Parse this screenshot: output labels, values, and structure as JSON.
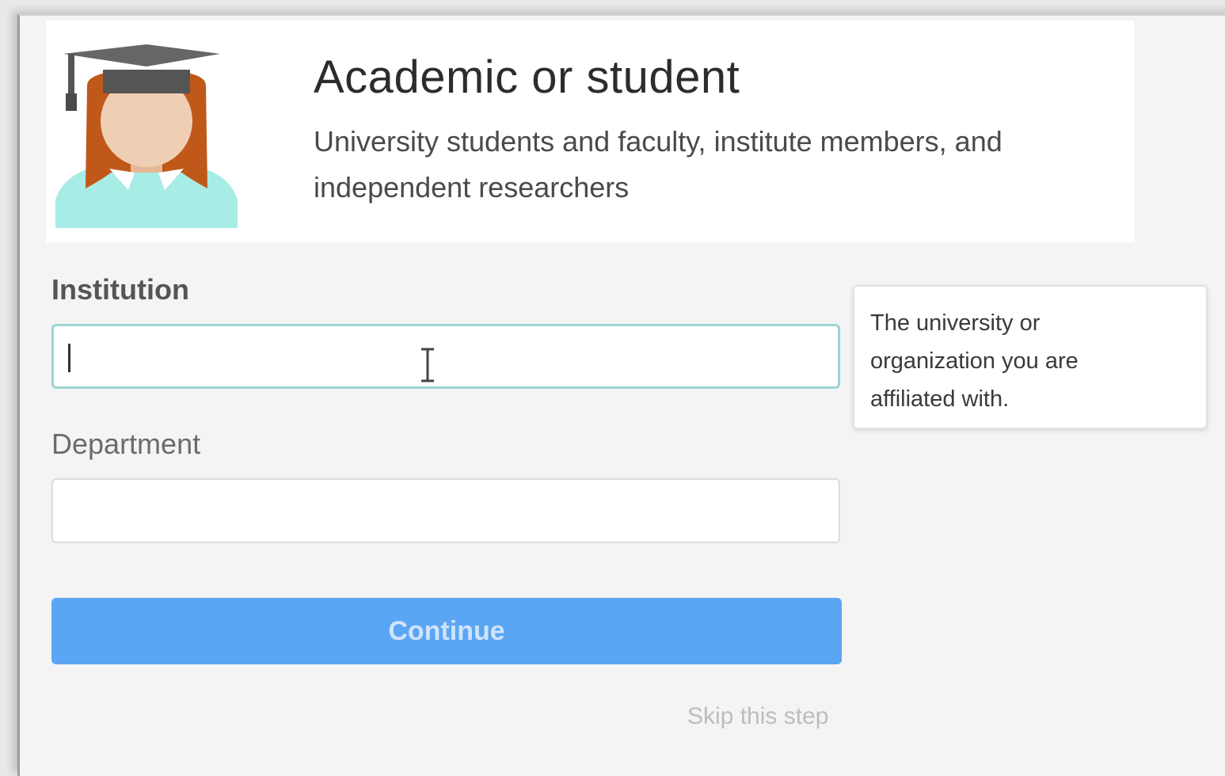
{
  "header": {
    "title": "Academic or student",
    "subtitle": "University students and faculty, institute members, and independent researchers",
    "avatar_icon": "graduate-avatar-icon"
  },
  "form": {
    "institution_label": "Institution",
    "institution_value": "",
    "institution_placeholder": "",
    "department_label": "Department",
    "department_value": "",
    "department_placeholder": "",
    "continue_label": "Continue",
    "skip_label": "Skip this step"
  },
  "tooltip": {
    "text": "The university or organization you are affiliated with."
  },
  "colors": {
    "accent": "#5aa6f4",
    "focus_border": "#9fd5d3",
    "avatar_hair": "#c0581a",
    "avatar_shirt": "#a8ece6",
    "cap": "#555555"
  }
}
